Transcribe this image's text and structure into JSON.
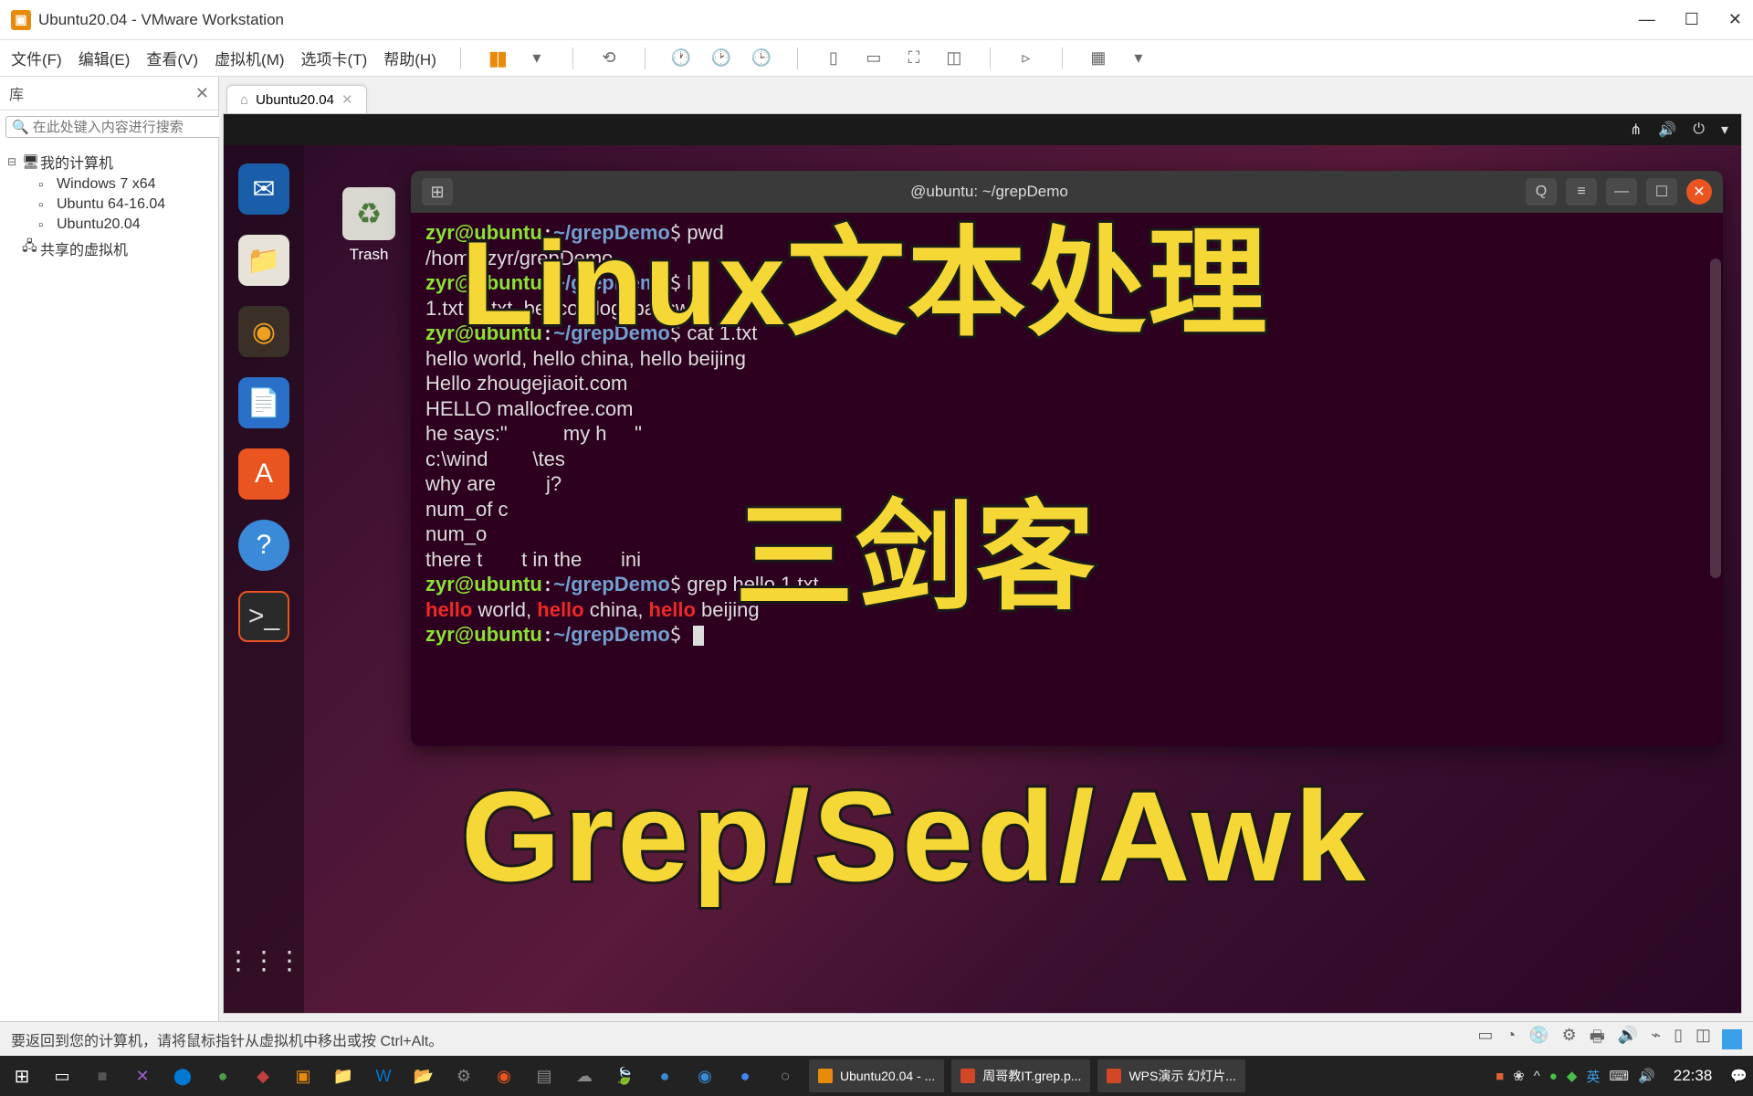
{
  "window": {
    "title": "Ubuntu20.04 - VMware Workstation"
  },
  "menu": {
    "file": "文件(F)",
    "edit": "编辑(E)",
    "view": "查看(V)",
    "vm": "虚拟机(M)",
    "tabs": "选项卡(T)",
    "help": "帮助(H)"
  },
  "sidebar": {
    "header": "库",
    "search_placeholder": "在此处键入内容进行搜索",
    "root": "我的计算机",
    "items": [
      "Windows 7 x64",
      "Ubuntu 64-16.04",
      "Ubuntu20.04"
    ],
    "shared": "共享的虚拟机"
  },
  "tab": {
    "label": "Ubuntu20.04"
  },
  "desktop": {
    "trash": "Trash"
  },
  "terminal": {
    "title": "@ubuntu: ~/grepDemo",
    "prompt_user": "zyr@ubuntu",
    "prompt_path": "~/grepDemo",
    "lines": {
      "pwd_cmd": " pwd",
      "pwd_out": "/home/zyr/grepDemo",
      "ls_cmd": " ls",
      "ls_out": "1.txt  2.txt  beacon.log  passwd",
      "cat_cmd": " cat 1.txt",
      "cat_l1": "hello world, hello china, hello beijing",
      "cat_l2": "Hello zhougejiaoit.com",
      "cat_l3": "HELLO mallocfree.com",
      "cat_l4": "he says:\"          my h     \"",
      "cat_l5": "c:\\wind        \\tes",
      "cat_l6": "why are         j?",
      "cat_l7": "num_of c",
      "cat_l8": "num_o",
      "cat_l9": "there t       t in the       ini",
      "grep_cmd": " grep hello 1.txt",
      "grep_w1": "hello",
      "grep_t1": " world, ",
      "grep_w2": "hello",
      "grep_t2": " china, ",
      "grep_w3": "hello",
      "grep_t3": " beijing"
    }
  },
  "overlays": {
    "line1": "Linux文本处理",
    "line2": "三剑客",
    "line3": "Grep/Sed/Awk"
  },
  "status": {
    "text": "要返回到您的计算机，请将鼠标指针从虚拟机中移出或按 Ctrl+Alt。"
  },
  "taskbar": {
    "apps": [
      {
        "label": "Ubuntu20.04 - ...",
        "color": "#e98b0a"
      },
      {
        "label": "周哥教IT.grep.p...",
        "color": "#d24726"
      },
      {
        "label": "WPS演示 幻灯片...",
        "color": "#d24726"
      }
    ],
    "time": "22:38"
  }
}
